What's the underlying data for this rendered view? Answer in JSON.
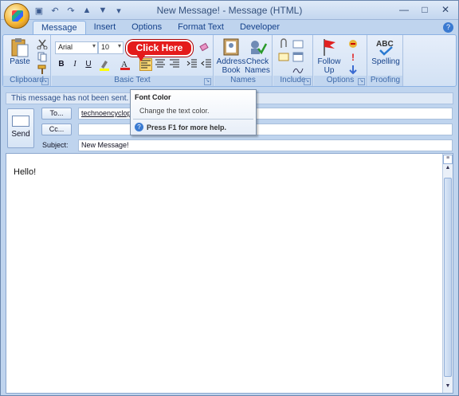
{
  "window": {
    "title": "New Message! - Message (HTML)"
  },
  "quick_access": [
    {
      "name": "save-icon",
      "glyph": "▣"
    },
    {
      "name": "undo-icon",
      "glyph": "↶"
    },
    {
      "name": "redo-icon",
      "glyph": "↷"
    },
    {
      "name": "up-icon",
      "glyph": "▲"
    },
    {
      "name": "down-icon",
      "glyph": "▼"
    },
    {
      "name": "customize-icon",
      "glyph": "▾"
    }
  ],
  "tabs": [
    "Message",
    "Insert",
    "Options",
    "Format Text",
    "Developer"
  ],
  "ribbon": {
    "groups": {
      "clipboard": "Clipboard",
      "basic_text": "Basic Text",
      "names": "Names",
      "include": "Include",
      "options": "Options",
      "proofing": "Proofing"
    },
    "paste": "Paste",
    "font_name": "Arial",
    "font_size": "10",
    "address_book": [
      "Address",
      "Book"
    ],
    "check_names": [
      "Check",
      "Names"
    ],
    "follow_up": [
      "Follow",
      "Up"
    ],
    "spelling": "Spelling",
    "abc": "ABC"
  },
  "callout": "Click Here",
  "tooltip": {
    "title": "Font Color",
    "description": "Change the text color.",
    "help": "Press F1 for more help."
  },
  "infobar": "This message has not been sent.",
  "header": {
    "send": "Send",
    "to_button": "To...",
    "cc_button": "Cc...",
    "subject_label": "Subject:",
    "to_value": "technoencyclopedia",
    "cc_value": "",
    "subject_value": "New Message!"
  },
  "body": {
    "text": "Hello!"
  }
}
